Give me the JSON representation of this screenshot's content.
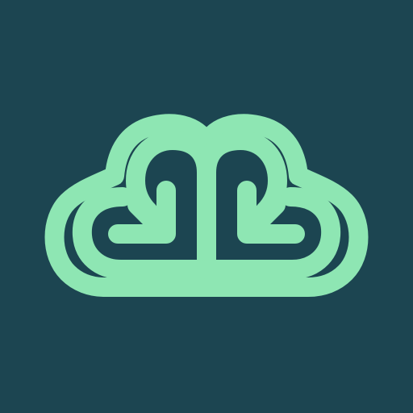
{
  "app_icon": {
    "icon": "cloud-heart-arrows-logo-icon",
    "colors": {
      "background": "#1c4551",
      "logo": "#8ee6b3"
    }
  }
}
